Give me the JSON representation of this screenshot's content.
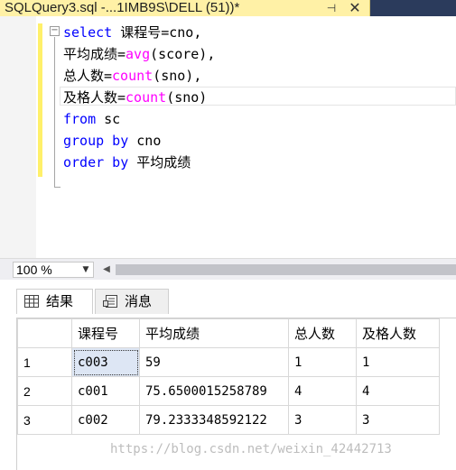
{
  "tab": {
    "title": "SQLQuery3.sql -...1IMB9S\\DELL (51))*",
    "pin_icon": "pin-icon",
    "close_icon": "close-icon"
  },
  "editor": {
    "lines": [
      [
        {
          "t": "select",
          "c": "kw"
        },
        {
          "t": " 课程号=cno,",
          "c": "ident"
        }
      ],
      [
        {
          "t": "平均成绩=",
          "c": "ident"
        },
        {
          "t": "avg",
          "c": "fn"
        },
        {
          "t": "(score),",
          "c": "ident"
        }
      ],
      [
        {
          "t": "总人数=",
          "c": "ident"
        },
        {
          "t": "count",
          "c": "fn"
        },
        {
          "t": "(sno),",
          "c": "ident"
        }
      ],
      [
        {
          "t": "及格人数=",
          "c": "ident"
        },
        {
          "t": "count",
          "c": "fn"
        },
        {
          "t": "(sno)",
          "c": "ident"
        }
      ],
      [
        {
          "t": "from",
          "c": "kw"
        },
        {
          "t": " sc",
          "c": "ident"
        }
      ],
      [
        {
          "t": "group by",
          "c": "kw"
        },
        {
          "t": " cno",
          "c": "ident"
        }
      ],
      [
        {
          "t": "order by",
          "c": "kw"
        },
        {
          "t": " 平均成绩",
          "c": "ident"
        }
      ]
    ]
  },
  "status": {
    "zoom": "100 %"
  },
  "results_tabs": {
    "results_label": "结果",
    "messages_label": "消息"
  },
  "grid": {
    "columns": [
      "",
      "课程号",
      "平均成绩",
      "总人数",
      "及格人数"
    ],
    "rows": [
      [
        "1",
        "c003",
        "59",
        "1",
        "1"
      ],
      [
        "2",
        "c001",
        "75.6500015258789",
        "4",
        "4"
      ],
      [
        "3",
        "c002",
        "79.2333348592122",
        "3",
        "3"
      ]
    ]
  },
  "watermark": "https://blog.csdn.net/weixin_42442713",
  "colors": {
    "keyword": "#0000ff",
    "function": "#ff00ff",
    "tab_active": "#fff1a6",
    "tabbar_bg": "#2b3b5c"
  }
}
